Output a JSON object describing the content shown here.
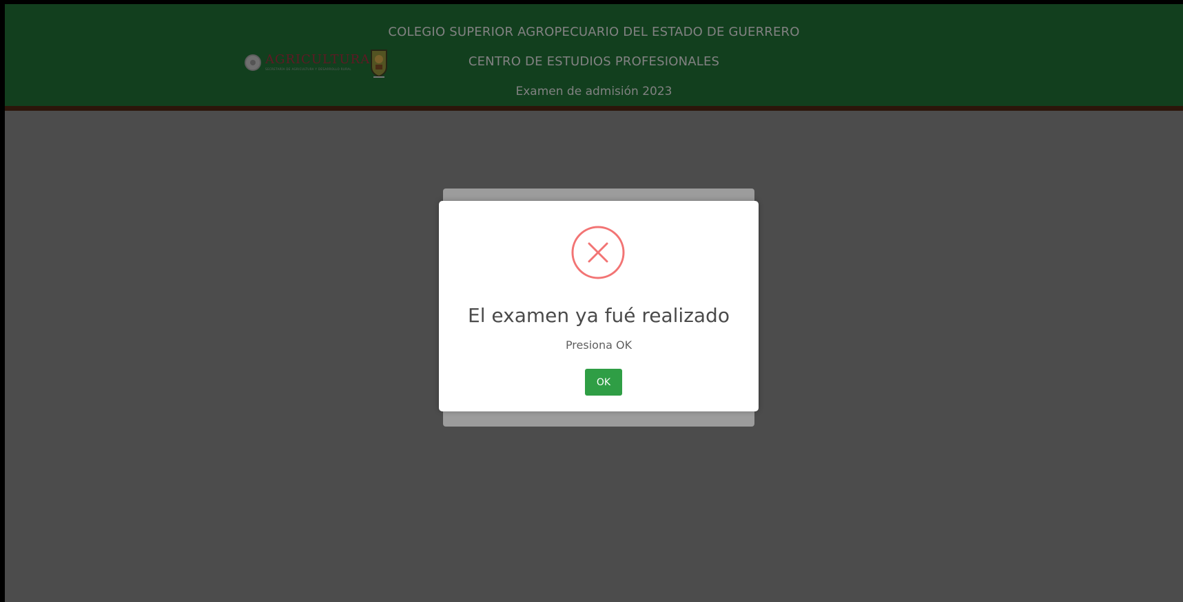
{
  "header": {
    "line1": "COLEGIO SUPERIOR AGROPECUARIO DEL ESTADO DE GUERRERO",
    "line2": "CENTRO DE ESTUDIOS PROFESIONALES",
    "line3": "Examen de admisión 2023",
    "logo_text": "AGRICULTURA",
    "logo_subtitle": "SECRETARÍA DE AGRICULTURA Y DESARROLLO RURAL",
    "background_color": "#1e6a33",
    "border_color": "#4a2412"
  },
  "modal": {
    "icon": "error-x-icon",
    "title": "El examen ya fué realizado",
    "text": "Presiona OK",
    "button_label": "OK",
    "icon_color": "#f27474",
    "button_color": "#2f9e45"
  }
}
